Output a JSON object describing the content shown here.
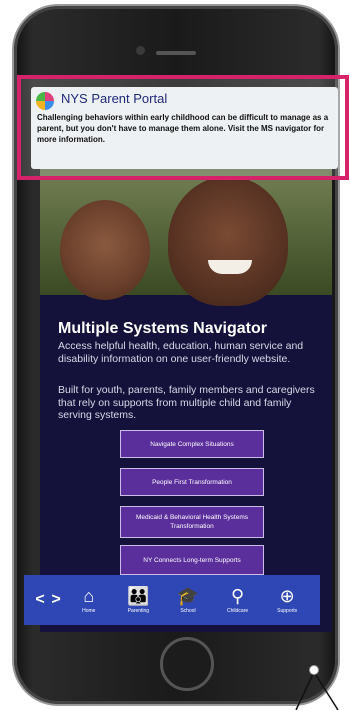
{
  "notification": {
    "app_name": "NYS Parent Portal",
    "time": "",
    "message": "Challenging behaviors within early childhood can be difficult to manage as a parent, but you don't have to manage them alone. Visit the MS navigator for more information."
  },
  "page": {
    "title": "Multiple Systems Navigator",
    "paragraph1": "Access helpful health, education, human service and disability information on one user-friendly website.",
    "paragraph2": "Built for youth, parents, family members and caregivers that rely on supports from multiple child and family serving systems."
  },
  "buttons": [
    {
      "label": "Navigate Complex Situations"
    },
    {
      "label": "People First Transformation"
    },
    {
      "label": "Medicaid & Behavioral Health Systems Transformation"
    },
    {
      "label": "NY Connects Long-term Supports"
    }
  ],
  "bottom_nav": {
    "back": "<",
    "forward": ">",
    "items": [
      {
        "label": "Home",
        "icon": "home-icon"
      },
      {
        "label": "Parenting",
        "icon": "parenting-icon"
      },
      {
        "label": "School",
        "icon": "school-icon"
      },
      {
        "label": "Childcare",
        "icon": "childcare-icon"
      },
      {
        "label": "Supports",
        "icon": "supports-icon"
      }
    ]
  },
  "colors": {
    "highlight": "#d6226b",
    "nav_bar": "#2f47b5",
    "button": "#5b2f9b",
    "screen_bg": "#14123a"
  }
}
